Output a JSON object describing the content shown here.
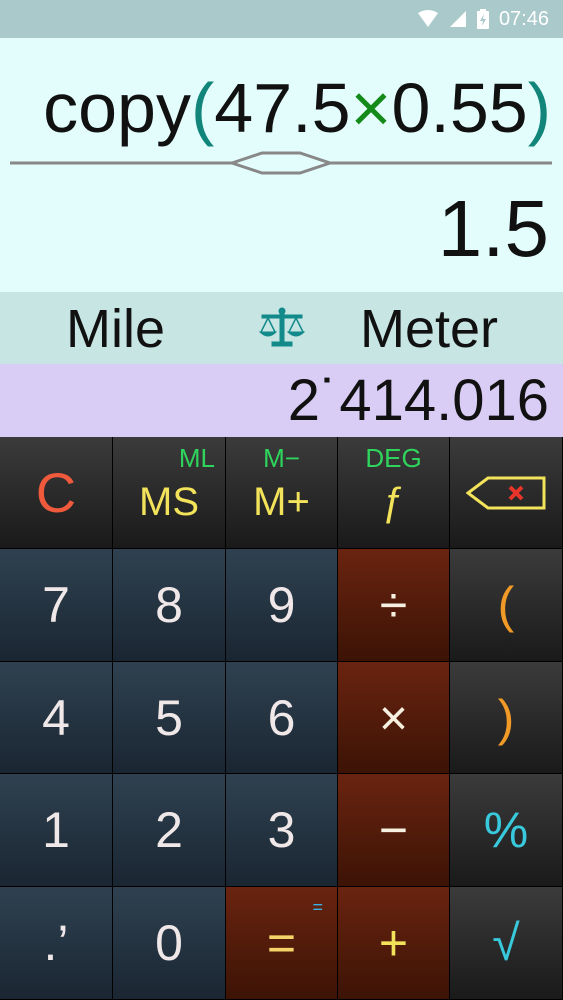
{
  "status_bar": {
    "time": "07:46"
  },
  "display": {
    "expression_prefix": "copy",
    "expression_open": "(",
    "expression_left": "47.5",
    "expression_operator": "×",
    "expression_right": "0.55",
    "expression_close": ")",
    "result": "1.5"
  },
  "converter": {
    "from_unit": "Mile",
    "to_unit": "Meter",
    "converted_value": "2˙414.016"
  },
  "keys": {
    "row1": [
      {
        "main": "C"
      },
      {
        "main": "MS",
        "sub": "ML"
      },
      {
        "main": "M+",
        "sub": "M−"
      },
      {
        "main": "ƒ",
        "sub": "DEG"
      },
      {
        "main": "backspace"
      }
    ],
    "row2": [
      "7",
      "8",
      "9",
      "÷",
      "("
    ],
    "row3": [
      "4",
      "5",
      "6",
      "×",
      ")"
    ],
    "row4": [
      "1",
      "2",
      "3",
      "−",
      "%"
    ],
    "row5": [
      ".’",
      "0",
      "=",
      "+",
      "√"
    ],
    "equals_sub": "="
  }
}
